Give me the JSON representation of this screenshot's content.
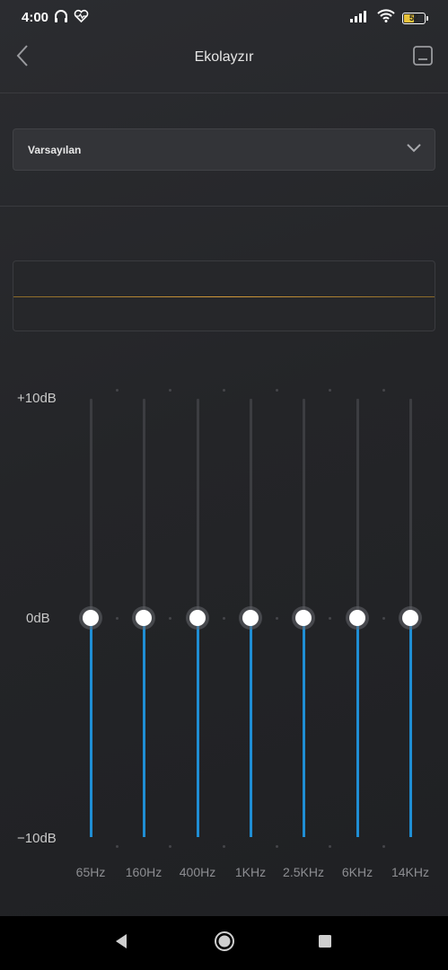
{
  "status_bar": {
    "time": "4:00",
    "battery_level": "52",
    "battery_fraction": 0.52,
    "left_icons": [
      "headphones-icon",
      "heart-pulse-icon"
    ],
    "right_icons": [
      "signal-icon",
      "wifi-icon",
      "battery-icon"
    ]
  },
  "header": {
    "title": "Ekolayzır",
    "back_icon": "chevron-left-icon",
    "save_icon": "save-preset-icon"
  },
  "preset": {
    "selected": "Varsayılan",
    "icon": "chevron-down-icon"
  },
  "curve": {
    "gain_db": 0,
    "line_color": "#d39a3a"
  },
  "equalizer": {
    "max_label": "+10dB",
    "zero_label": "0dB",
    "min_label": "−10dB",
    "range_db": [
      -10,
      10
    ],
    "fill_color": "#1f8ed4",
    "bands": [
      {
        "label": "65Hz",
        "gain_db": 0
      },
      {
        "label": "160Hz",
        "gain_db": 0
      },
      {
        "label": "400Hz",
        "gain_db": 0
      },
      {
        "label": "1KHz",
        "gain_db": 0
      },
      {
        "label": "2.5KHz",
        "gain_db": 0
      },
      {
        "label": "6KHz",
        "gain_db": 0
      },
      {
        "label": "14KHz",
        "gain_db": 0
      }
    ]
  },
  "nav_bar": {
    "back_icon": "nav-back-triangle-icon",
    "home_icon": "nav-home-circle-icon",
    "recents_icon": "nav-recents-square-icon"
  }
}
